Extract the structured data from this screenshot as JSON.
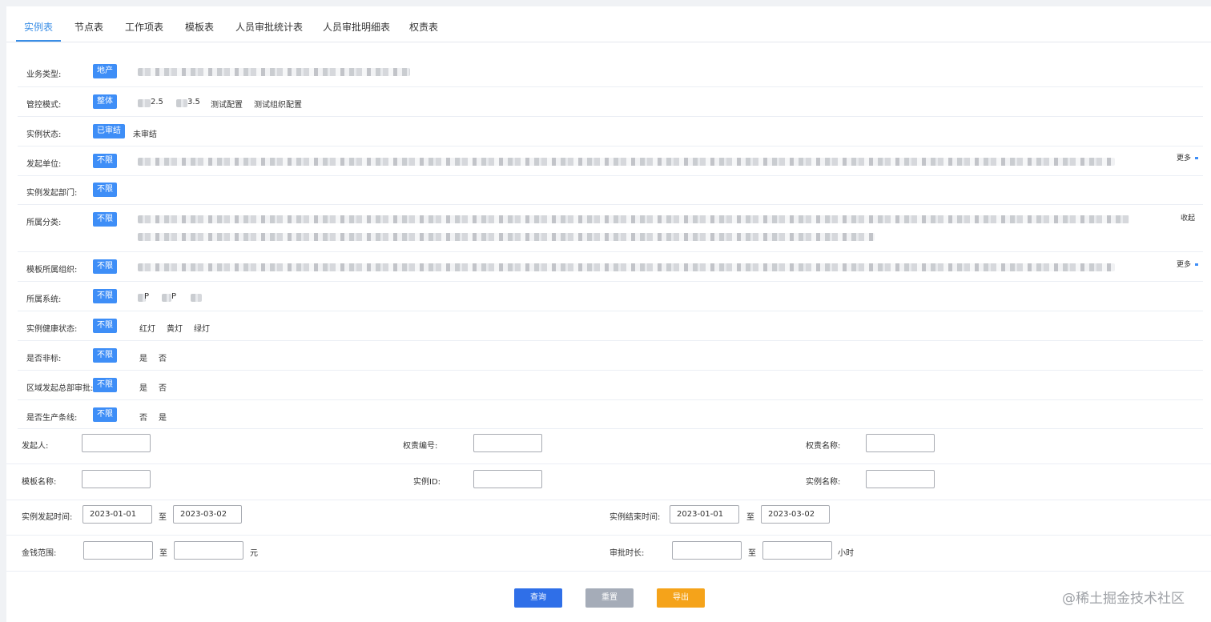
{
  "tabs": [
    {
      "label": "实例表",
      "active": true
    },
    {
      "label": "节点表"
    },
    {
      "label": "工作项表"
    },
    {
      "label": "模板表"
    },
    {
      "label": "人员审批统计表"
    },
    {
      "label": "人员审批明细表"
    },
    {
      "label": "权责表"
    }
  ],
  "filters": {
    "business_type": {
      "label": "业务类型:",
      "selected": "地产"
    },
    "control_mode": {
      "label": "管控模式:",
      "selected": "整体",
      "options": [
        "2.5",
        "3.5",
        "测试配置",
        "测试组织配置"
      ]
    },
    "instance_status": {
      "label": "实例状态:",
      "selected": "已审结",
      "options": [
        "未审结"
      ]
    },
    "initiating_unit": {
      "label": "发起单位:",
      "selected": "不限",
      "toggle": "更多"
    },
    "instance_dept": {
      "label": "实例发起部门:",
      "selected": "不限"
    },
    "category": {
      "label": "所属分类:",
      "selected": "不限",
      "toggle": "收起"
    },
    "template_org": {
      "label": "模板所属组织:",
      "selected": "不限",
      "toggle": "更多"
    },
    "system": {
      "label": "所属系统:",
      "selected": "不限",
      "options": [
        "P",
        "P"
      ]
    },
    "health_status": {
      "label": "实例健康状态:",
      "selected": "不限",
      "options": [
        "红灯",
        "黄灯",
        "绿灯"
      ]
    },
    "non_standard": {
      "label": "是否非标:",
      "selected": "不限",
      "options": [
        "是",
        "否"
      ]
    },
    "region_hq": {
      "label": "区域发起总部审批:",
      "selected": "不限",
      "options": [
        "是",
        "否"
      ]
    },
    "production_line": {
      "label": "是否生产条线:",
      "selected": "不限",
      "options": [
        "否",
        "是"
      ]
    }
  },
  "search": {
    "initiator": {
      "label": "发起人:",
      "value": ""
    },
    "authority_no": {
      "label": "权责编号:",
      "value": ""
    },
    "authority_name": {
      "label": "权责名称:",
      "value": ""
    },
    "template_name": {
      "label": "模板名称:",
      "value": ""
    },
    "instance_id": {
      "label": "实例ID:",
      "value": ""
    },
    "instance_name": {
      "label": "实例名称:",
      "value": ""
    },
    "start_time": {
      "label": "实例发起时间:",
      "from": "2023-01-01",
      "to": "2023-03-02"
    },
    "end_time": {
      "label": "实例结束时间:",
      "from": "2023-01-01",
      "to": "2023-03-02"
    },
    "amount": {
      "label": "金钱范围:",
      "from": "",
      "to": "",
      "unit": "元"
    },
    "duration": {
      "label": "审批时长:",
      "from": "",
      "to": "",
      "unit": "小时"
    },
    "range_sep": "至"
  },
  "buttons": {
    "query": "查询",
    "reset": "重置",
    "export": "导出"
  },
  "watermark": "@稀土掘金技术社区",
  "colors": {
    "primary": "#3e8ef7",
    "query": "#2f6fe8",
    "reset": "#a5acb8",
    "export": "#f5a31a",
    "tab_active": "#3a8ee6"
  }
}
